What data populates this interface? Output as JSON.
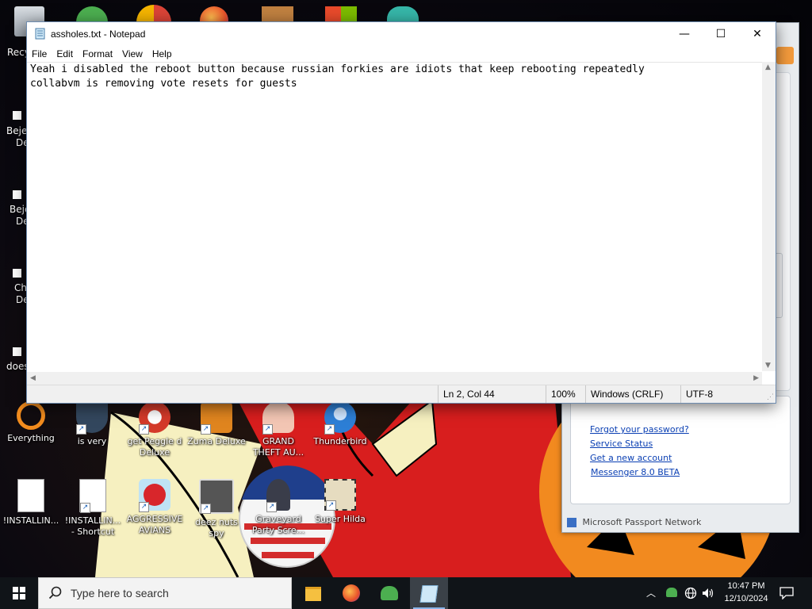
{
  "notepad": {
    "title": "assholes.txt - Notepad",
    "menu": [
      "File",
      "Edit",
      "Format",
      "View",
      "Help"
    ],
    "content": "Yeah i disabled the reboot button because russian forkies are idiots that keep rebooting repeatedly\ncollabvm is removing vote resets for guests",
    "status": {
      "position": "Ln 2, Col 44",
      "zoom": "100%",
      "line_endings": "Windows (CRLF)",
      "encoding": "UTF-8"
    }
  },
  "messenger": {
    "links": [
      "Forgot your password?",
      "Service Status",
      "Get a new account",
      "Messenger 8.0 BETA"
    ],
    "footer": "Microsoft Passport Network"
  },
  "desktop": {
    "left_edge_labels": [
      "Recy",
      "Bejev",
      "De",
      "Beje",
      "De",
      "Ch",
      "De",
      "does"
    ],
    "icons": [
      {
        "label": "Everything",
        "icon": "everything-icon",
        "color": "#f28c1e"
      },
      {
        "label": "is very",
        "icon": "shield-icon",
        "color": "#33475e"
      },
      {
        "label": "get Peggle d Deluxe",
        "icon": "peggle-icon",
        "color": "#d43a2a"
      },
      {
        "label": "Zuma Deluxe",
        "icon": "zuma-icon",
        "color": "#e0851f"
      },
      {
        "label": "GRAND THEFT AU...",
        "icon": "anime-girl-icon",
        "color": "#e77b6b"
      },
      {
        "label": "Thunderbird",
        "icon": "thunderbird-icon",
        "color": "#2d7fd6"
      },
      {
        "label": "!INSTALLIN...",
        "icon": "document-icon",
        "color": "#ffffff"
      },
      {
        "label": "!INSTALLIN... - Shortcut",
        "icon": "document-icon",
        "color": "#ffffff"
      },
      {
        "label": "AGGRESSIVE AVIANS",
        "icon": "angry-bird-icon",
        "color": "#d8262b"
      },
      {
        "label": "deez nuts spy",
        "icon": "windows-stack-icon",
        "color": "#3a3a3a"
      },
      {
        "label": "Graveyard Party Scre...",
        "icon": "voted-sticker-icon",
        "color": "#1f3f8c"
      },
      {
        "label": "Super Hilda",
        "icon": "pixel-dog-icon",
        "color": "#e6dcc0"
      }
    ],
    "top_partial_icons": [
      "recycle-bin-icon",
      "users-icon",
      "chrome-icon",
      "firefox-icon",
      "app-icon",
      "office-icon",
      "anime-icon"
    ]
  },
  "taskbar": {
    "search_placeholder": "Type here to search",
    "apps": [
      "file-explorer-icon",
      "firefox-icon",
      "messenger-icon",
      "notepad-icon"
    ],
    "tray_icons": [
      "chevron-up-icon",
      "messenger-tray-icon",
      "network-icon",
      "volume-icon"
    ],
    "time": "10:47 PM",
    "date": "12/10/2024",
    "notification_icon": "notification-icon"
  }
}
